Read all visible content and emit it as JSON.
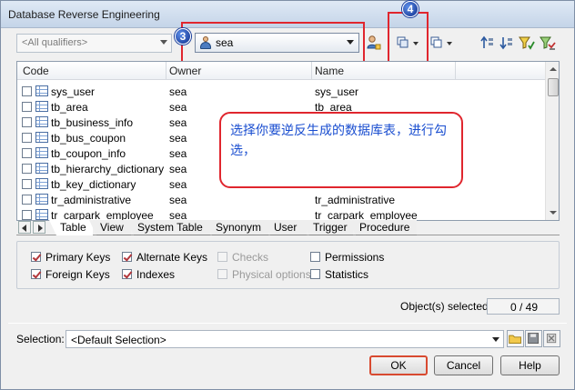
{
  "window": {
    "title": "Database Reverse Engineering"
  },
  "toolbar": {
    "qualifier": {
      "value": "<All qualifiers>"
    },
    "owner": {
      "value": "sea"
    }
  },
  "callouts": {
    "badge3": "3",
    "badge4": "4"
  },
  "grid": {
    "columns": [
      "Code",
      "Owner",
      "Name"
    ],
    "rows": [
      {
        "code": "sys_user",
        "owner": "sea",
        "name": "sys_user"
      },
      {
        "code": "tb_area",
        "owner": "sea",
        "name": "tb_area"
      },
      {
        "code": "tb_business_info",
        "owner": "sea",
        "name": ""
      },
      {
        "code": "tb_bus_coupon",
        "owner": "sea",
        "name": ""
      },
      {
        "code": "tb_coupon_info",
        "owner": "sea",
        "name": ""
      },
      {
        "code": "tb_hierarchy_dictionary",
        "owner": "sea",
        "name": ""
      },
      {
        "code": "tb_key_dictionary",
        "owner": "sea",
        "name": ""
      },
      {
        "code": "tr_administrative",
        "owner": "sea",
        "name": "tr_administrative"
      },
      {
        "code": "tr_carpark_employee",
        "owner": "sea",
        "name": "tr_carpark_employee"
      }
    ]
  },
  "tabs": [
    "Table",
    "View",
    "System Table",
    "Synonym",
    "User",
    "Trigger",
    "Procedure"
  ],
  "options": {
    "primary_keys": "Primary Keys",
    "foreign_keys": "Foreign Keys",
    "alternate_keys": "Alternate Keys",
    "indexes": "Indexes",
    "checks": "Checks",
    "physical_options": "Physical options",
    "permissions": "Permissions",
    "statistics": "Statistics"
  },
  "status": {
    "label": "Object(s) selected:",
    "value": "0 / 49"
  },
  "selection": {
    "label": "Selection:",
    "value": "<Default Selection>"
  },
  "buttons": {
    "ok": "OK",
    "cancel": "Cancel",
    "help": "Help"
  },
  "annotation": {
    "text": "选择你要逆反生成的数据库表，进行勾选，"
  },
  "colors": {
    "callout_red": "#e0262e",
    "badge_blue": "#1a3fa8",
    "annotation_text": "#1a4ed0"
  }
}
